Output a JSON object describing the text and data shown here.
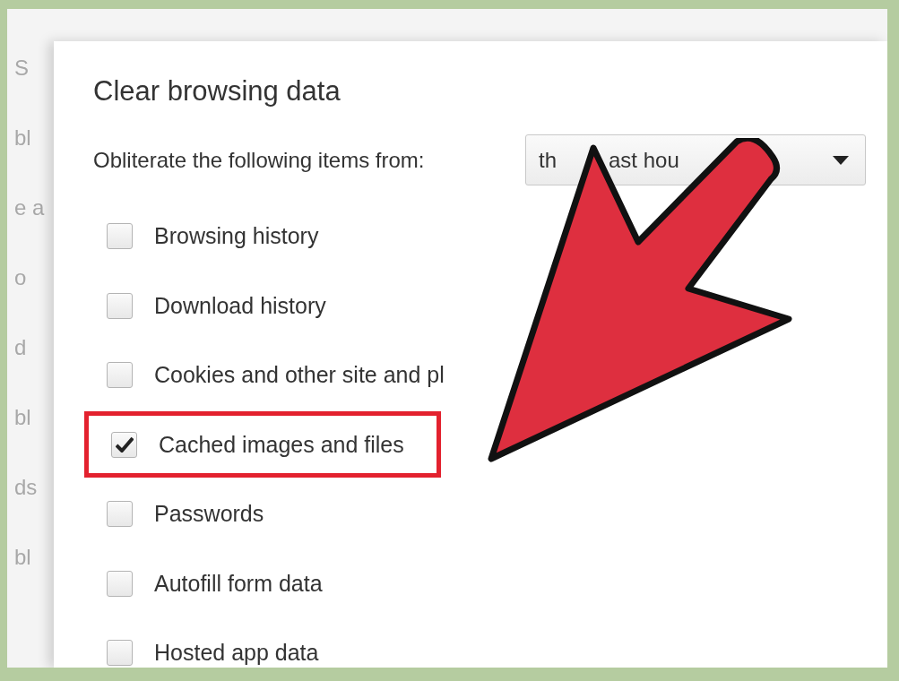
{
  "background_page": {
    "fragments": [
      "S",
      "bl",
      "e a",
      "o",
      "d",
      "bl",
      "ds",
      "bl"
    ]
  },
  "dialog": {
    "title": "Clear browsing data",
    "range_label": "Obliterate the following items from:",
    "range_dropdown": {
      "value_parts": [
        "th",
        "ast hou"
      ]
    },
    "items": [
      {
        "label": "Browsing history",
        "checked": false,
        "highlighted": false
      },
      {
        "label": "Download history",
        "checked": false,
        "highlighted": false
      },
      {
        "label": "Cookies and other site and pl",
        "checked": false,
        "highlighted": false
      },
      {
        "label": "Cached images and files",
        "checked": true,
        "highlighted": true
      },
      {
        "label": "Passwords",
        "checked": false,
        "highlighted": false
      },
      {
        "label": "Autofill form data",
        "checked": false,
        "highlighted": false
      },
      {
        "label": "Hosted app data",
        "checked": false,
        "highlighted": false
      }
    ]
  }
}
